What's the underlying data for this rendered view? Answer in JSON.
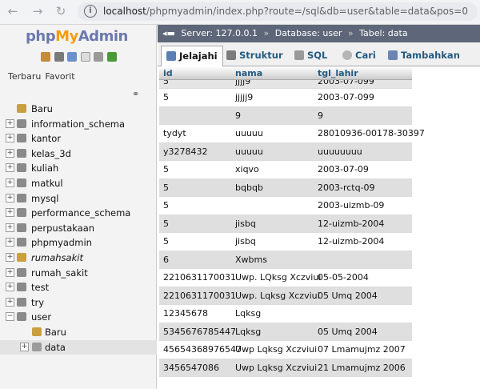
{
  "browser": {
    "url_host": "localhost",
    "url_rest": "/phpmyadmin/index.php?route=/sql&db=user&table=data&pos=0"
  },
  "sidebar": {
    "logo_php": "php",
    "logo_my": "My",
    "logo_admin": "Admin",
    "tab_recent": "Terbaru",
    "tab_favorites": "Favorit",
    "new_label": "Baru",
    "databases": [
      {
        "label": "information_schema"
      },
      {
        "label": "kantor"
      },
      {
        "label": "kelas_3d"
      },
      {
        "label": "kuliah"
      },
      {
        "label": "matkul"
      },
      {
        "label": "mysql"
      },
      {
        "label": "performance_schema"
      },
      {
        "label": "perpustakaan"
      },
      {
        "label": "phpmyadmin"
      },
      {
        "label": "rumahsakit"
      },
      {
        "label": "rumah_sakit"
      },
      {
        "label": "test"
      },
      {
        "label": "try"
      },
      {
        "label": "user"
      }
    ],
    "user_children": [
      {
        "label": "Baru"
      },
      {
        "label": "data"
      }
    ]
  },
  "breadcrumb": {
    "server": "Server: 127.0.0.1",
    "database": "Database: user",
    "table": "Tabel: data"
  },
  "tabs": [
    {
      "label": "Jelajahi"
    },
    {
      "label": "Struktur"
    },
    {
      "label": "SQL"
    },
    {
      "label": "Cari"
    },
    {
      "label": "Tambahkan"
    }
  ],
  "table": {
    "headers": [
      "id",
      "nama",
      "tgl_lahir"
    ],
    "partial_row": [
      "5",
      "jjjj9",
      "2003-07-099"
    ],
    "rows": [
      [
        "5",
        "jjjjj9",
        "2003-07-099"
      ],
      [
        "",
        "9",
        "9"
      ],
      [
        "tydyt",
        "uuuuu",
        "28010936-00178-30397"
      ],
      [
        "y3278432",
        "uuuuu",
        "uuuuuuuu"
      ],
      [
        "5",
        "xiqvo",
        "2003-07-09"
      ],
      [
        "5",
        "bqbqb",
        "2003-rctq-09"
      ],
      [
        "5",
        "",
        "2003-uizmb-09"
      ],
      [
        "5",
        "jisbq",
        "12-uizmb-2004"
      ],
      [
        "5",
        "jisbq",
        "12-uizmb-2004"
      ],
      [
        "6",
        "Xwbms",
        ""
      ],
      [
        "2210631170031",
        "Uwp. LQksg Xczviui",
        "05-05-2004"
      ],
      [
        "2210631170031",
        "Uwp. Lqksg Xczviui",
        "05 Umq 2004"
      ],
      [
        "12345678",
        "Lqksg",
        ""
      ],
      [
        "5345676785447",
        "Lqksg",
        "05 Umq 2004"
      ],
      [
        "45654368976547",
        "Uwp Lqksg Xczviui",
        "07 Lmamujmz 2007"
      ],
      [
        "3456547086",
        "Uwp Lqksg Xczviui",
        "21 Lmamujmz 2006"
      ]
    ]
  }
}
